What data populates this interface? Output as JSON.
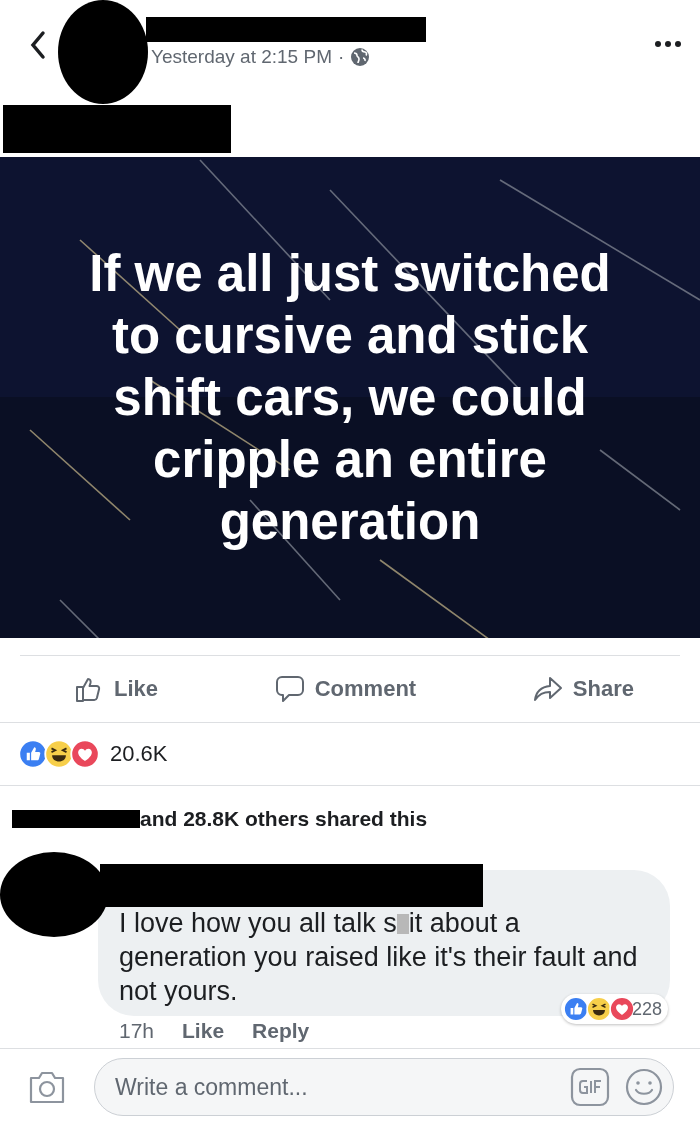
{
  "post": {
    "timestamp": "Yesterday at 2:15 PM",
    "separator": "·",
    "image_text": "If we all just switched\nto cursive and stick\nshift cars, we could\ncripple an entire\ngeneration",
    "actions": [
      {
        "kind": "like",
        "label": "Like"
      },
      {
        "kind": "comment",
        "label": "Comment"
      },
      {
        "kind": "share",
        "label": "Share"
      }
    ],
    "reactions": [
      {
        "kind": "like"
      },
      {
        "kind": "haha"
      },
      {
        "kind": "love"
      }
    ],
    "reaction_count": "20.6K",
    "shares": "and 28.8K others shared this"
  },
  "comment": {
    "text_parts": [
      "I love how you all talk s",
      "it about a generation you raised like it's their fault and not yours."
    ],
    "time": "17h",
    "actions": [
      "Like",
      "Reply"
    ],
    "reactions": [
      {
        "kind": "like"
      },
      {
        "kind": "haha"
      },
      {
        "kind": "love"
      }
    ],
    "reaction_count": "228"
  },
  "composer": {
    "placeholder": "Write a comment..."
  }
}
